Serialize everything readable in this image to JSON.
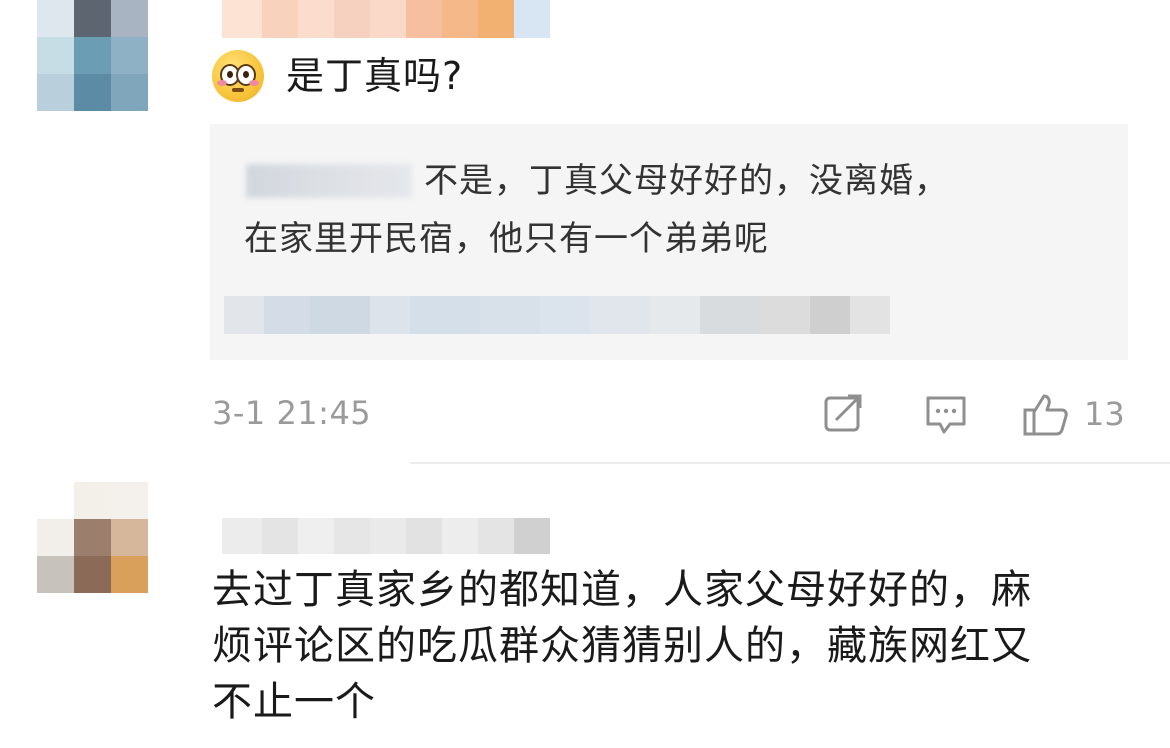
{
  "comment_1": {
    "text": "是丁真吗?",
    "emoji": "flushed-face-emoji",
    "reply": {
      "line_1": "不是，丁真父母好好的，没离婚，",
      "line_2": "在家里开民宿，他只有一个弟弟呢"
    },
    "timestamp": "3-1 21:45",
    "like_count": "13",
    "icons": [
      "share-icon",
      "comment-icon",
      "like-icon"
    ]
  },
  "comment_2": {
    "line_1": "去过丁真家乡的都知道，人家父母好好的，麻",
    "line_2": "烦评论区的吃瓜群众猜猜别人的，藏族网红又",
    "line_3": "不止一个"
  },
  "colors": {
    "meta_gray": "#9a9a9a",
    "reply_bg": "#f5f5f5"
  }
}
